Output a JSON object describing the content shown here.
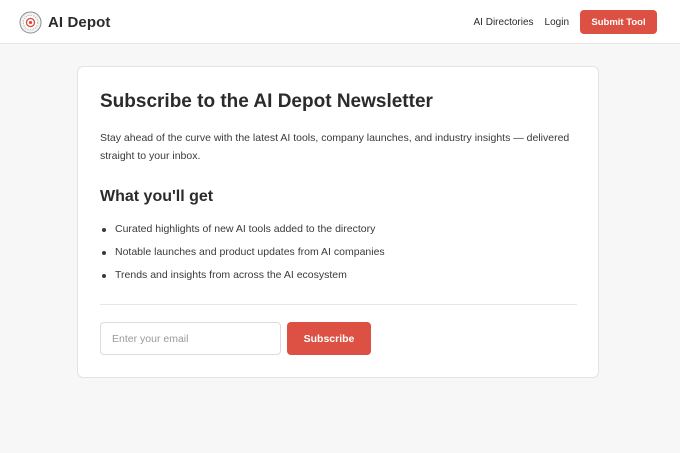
{
  "header": {
    "brand_name": "AI Depot",
    "logo_icon": "ai-depot-logo-icon",
    "nav_links": [
      "AI Directories",
      "Login"
    ],
    "submit_label": "Submit Tool"
  },
  "newsletter": {
    "title": "Subscribe to the AI Depot Newsletter",
    "intro": "Stay ahead of the curve with the latest AI tools, company launches, and industry insights — delivered straight to your inbox.",
    "section_title": "What you'll get",
    "benefits": [
      "Curated highlights of new AI tools added to the directory",
      "Notable launches and product updates from AI companies",
      "Trends and insights from across the AI ecosystem"
    ],
    "email_placeholder": "Enter your email",
    "email_value": "",
    "subscribe_label": "Subscribe"
  },
  "colors": {
    "accent": "#dc5143",
    "page_background": "#f7f7f7",
    "card_background": "#ffffff",
    "text": "#2b2b2b"
  }
}
